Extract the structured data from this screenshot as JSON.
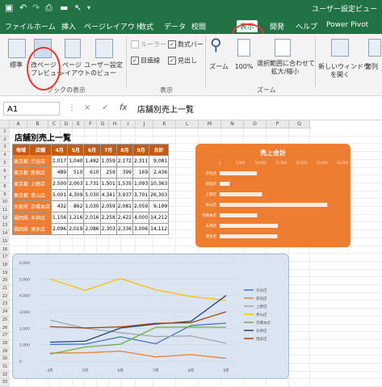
{
  "title_bar": {
    "window_title": "ユーザー設定ビュー"
  },
  "tabs": [
    "ファイル",
    "ホーム",
    "挿入",
    "ページレイアウト",
    "数式",
    "データ",
    "校閲",
    "表示",
    "開発",
    "ヘルプ",
    "Power Pivot"
  ],
  "active_tab": "表示",
  "ribbon": {
    "normal": "標準",
    "page_break_1": "改ページ",
    "page_break_2": "プレビュー",
    "page_layout_1": "ページ",
    "page_layout_2": "レイアウト",
    "custom_view_1": "ユーザー設定",
    "custom_view_2": "のビュー",
    "group_views": "ブックの表示",
    "ruler": "ルーラー",
    "formula_bar": "数式バー",
    "gridlines": "目盛線",
    "headings": "見出し",
    "group_show": "表示",
    "zoom": "ズーム",
    "zoom_100": "100%",
    "zoom_sel_1": "選択範囲に合わせて",
    "zoom_sel_2": "拡大/縮小",
    "group_zoom": "ズーム",
    "new_window_1": "新しいウィンドウ",
    "new_window_2": "を開く",
    "arrange": "整列"
  },
  "formula_bar": {
    "cell": "A1",
    "x": "×",
    "check": "✓",
    "fx": "fx",
    "content": "店舗別売上一覧"
  },
  "columns": [
    "A",
    "B",
    "C",
    "D",
    "E",
    "F",
    "G",
    "H",
    "I",
    "J",
    "K",
    "L",
    "M",
    "N",
    "O",
    "P",
    "Q"
  ],
  "rows": [
    "1",
    "2",
    "3",
    "4",
    "5",
    "6",
    "7",
    "8",
    "9",
    "10",
    "11",
    "12",
    "13",
    "14",
    "15",
    "16",
    "17",
    "18",
    "19",
    "20",
    "21",
    "22",
    "23",
    "24",
    "25",
    "26",
    "27",
    "28",
    "29",
    "30",
    "31",
    "32",
    "33"
  ],
  "sheet": {
    "title": "店舗別売上一覧",
    "headers": [
      "地域",
      "店舗",
      "4月",
      "5月",
      "6月",
      "7月",
      "8月",
      "9月",
      "合計"
    ],
    "rows": [
      [
        "東京都",
        "渋谷店",
        "1,017",
        "1,040",
        "1,482",
        "1,059",
        "2,172",
        "2,311",
        "9,081"
      ],
      [
        "東京都",
        "新宿店",
        "489",
        "510",
        "610",
        "259",
        "399",
        "169",
        "2,436"
      ],
      [
        "東京都",
        "上野店",
        "2,500",
        "2,003",
        "1,731",
        "1,501",
        "1,535",
        "1,093",
        "10,363"
      ],
      [
        "東京都",
        "青山店",
        "5,001",
        "4,309",
        "5,030",
        "4,341",
        "3,937",
        "3,701",
        "26,303"
      ],
      [
        "大阪府",
        "京橋本店",
        "432",
        "862",
        "1,030",
        "2,059",
        "2,081",
        "2,059",
        "9,199"
      ],
      [
        "福岡県",
        "天神店",
        "1,156",
        "1,216",
        "2,016",
        "2,258",
        "2,422",
        "4,000",
        "14,212"
      ],
      [
        "福岡県",
        "博多店",
        "2,096",
        "2,019",
        "2,086",
        "2,303",
        "2,336",
        "3,006",
        "14,112"
      ]
    ]
  },
  "bar_chart": {
    "title": "売上合計",
    "axis_ticks": [
      "0",
      "5,000",
      "10,000",
      "15,000",
      "20,000",
      "25,000",
      "30,000"
    ],
    "categories": [
      "渋谷店",
      "新宿店",
      "上野店",
      "青山店",
      "京橋本店",
      "天神店",
      "博多店"
    ],
    "values": [
      9081,
      2436,
      10363,
      26303,
      9199,
      14212,
      14112
    ],
    "color": "#ed7d31"
  },
  "chart_data": {
    "type": "line",
    "x": [
      "4月",
      "5月",
      "6月",
      "7月",
      "8月",
      "9月"
    ],
    "ylim": [
      0,
      6000
    ],
    "y_ticks": [
      "0",
      "1,000",
      "2,000",
      "3,000",
      "4,000",
      "5,000",
      "6,000"
    ],
    "series": [
      {
        "name": "渋谷店",
        "color": "#4472c4",
        "values": [
          1017,
          1040,
          1482,
          1059,
          2172,
          2311
        ]
      },
      {
        "name": "新宿店",
        "color": "#ed7d31",
        "values": [
          489,
          510,
          610,
          259,
          399,
          169
        ]
      },
      {
        "name": "上野店",
        "color": "#a5a5a5",
        "values": [
          2500,
          2003,
          1731,
          1501,
          1535,
          1093
        ]
      },
      {
        "name": "青山店",
        "color": "#ffc000",
        "values": [
          5001,
          4309,
          5030,
          4341,
          3937,
          3701
        ]
      },
      {
        "name": "京橋本店",
        "color": "#70ad47",
        "values": [
          432,
          862,
          1030,
          2059,
          2081,
          2059
        ]
      },
      {
        "name": "天神店",
        "color": "#264478",
        "values": [
          1156,
          1216,
          2016,
          2258,
          2422,
          4000
        ]
      },
      {
        "name": "博多店",
        "color": "#9e480e",
        "values": [
          2096,
          2019,
          2086,
          2303,
          2336,
          3006
        ]
      }
    ]
  }
}
